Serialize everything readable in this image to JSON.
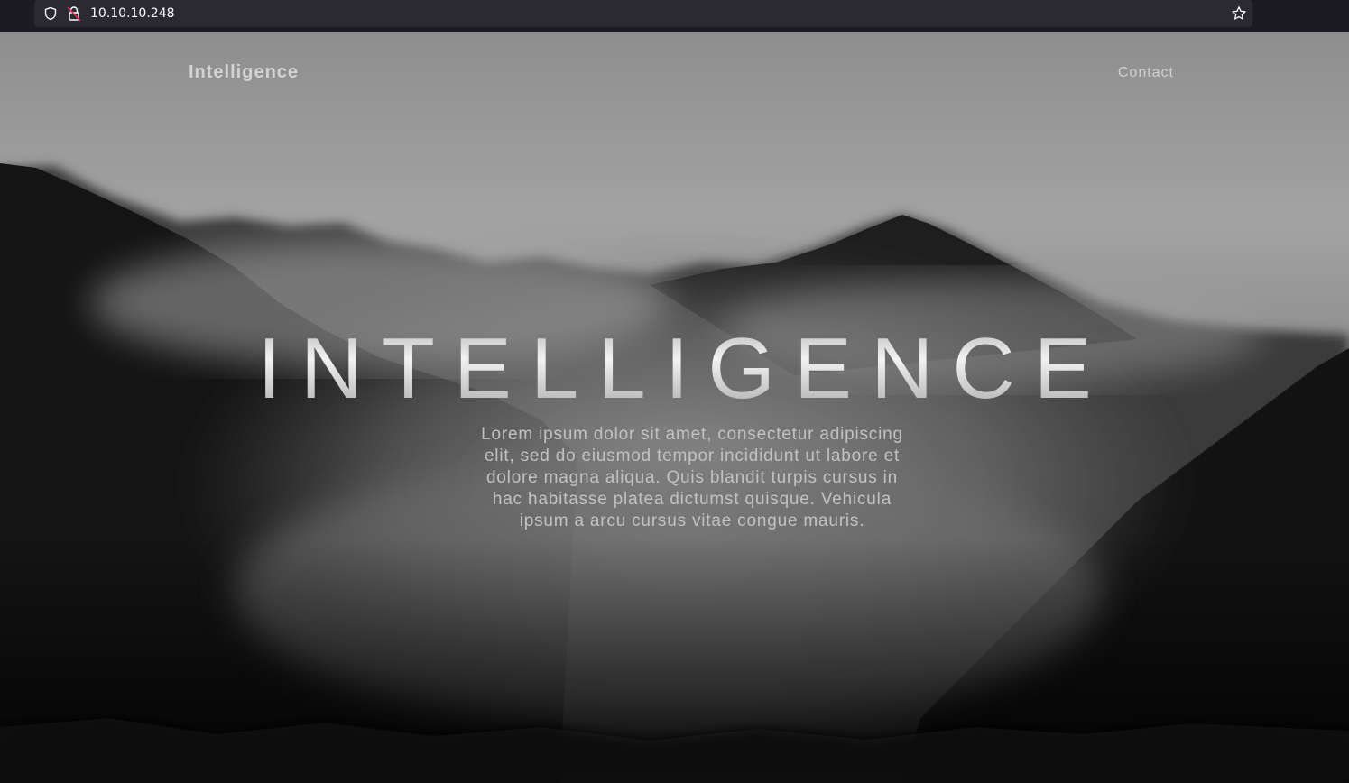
{
  "browser": {
    "url": "10.10.10.248"
  },
  "nav": {
    "brand": "Intelligence",
    "contact": "Contact"
  },
  "hero": {
    "title": "INTELLIGENCE",
    "description": "Lorem ipsum dolor sit amet, consectetur adipiscing elit, sed do eiusmod tempor incididunt ut labore et dolore magna aliqua. Quis blandit turpis cursus in hac habitasse platea dictumst quisque. Vehicula ipsum a arcu cursus vitae congue mauris."
  },
  "colors": {
    "browser_bg": "#1c1b22",
    "url_bar_bg": "#2b2a33",
    "lock_accent": "#e22850"
  }
}
